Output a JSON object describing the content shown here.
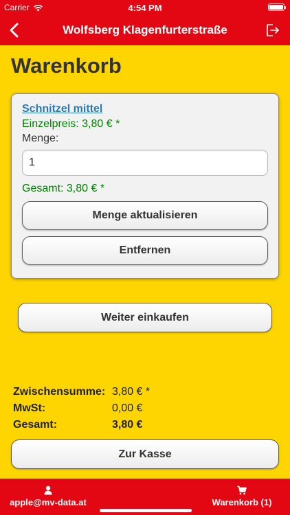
{
  "statusbar": {
    "carrier": "Carrier",
    "time": "4:54 PM",
    "battery_level": 1.0
  },
  "navbar": {
    "title": "Wolfsberg Klagenfurterstraße",
    "back_icon": "chevron-left-icon",
    "logout_icon": "logout-icon"
  },
  "page": {
    "title": "Warenkorb"
  },
  "cart_item": {
    "name": "Schnitzel mittel",
    "unit_price": "Einzelpreis: 3,80 € *",
    "quantity_label": "Menge:",
    "quantity_value": "1",
    "line_total": "Gesamt: 3,80 € *",
    "update_label": "Menge aktualisieren",
    "remove_label": "Entfernen"
  },
  "continue_label": "Weiter einkaufen",
  "summary": {
    "subtotal_label": "Zwischensumme:",
    "subtotal_value": "3,80 € *",
    "tax_label": "MwSt:",
    "tax_value": "0,00 €",
    "total_label": "Gesamt:",
    "total_value": "3,80 €"
  },
  "checkout_label": "Zur Kasse",
  "tabbar": {
    "user_label": "apple@mv-data.at",
    "user_icon": "user-icon",
    "cart_label": "Warenkorb (1)",
    "cart_icon": "cart-icon"
  },
  "colors": {
    "brand_red": "#e30613",
    "background_yellow": "#ffd500",
    "price_green": "#008000",
    "link_blue": "#2a7ab8"
  }
}
